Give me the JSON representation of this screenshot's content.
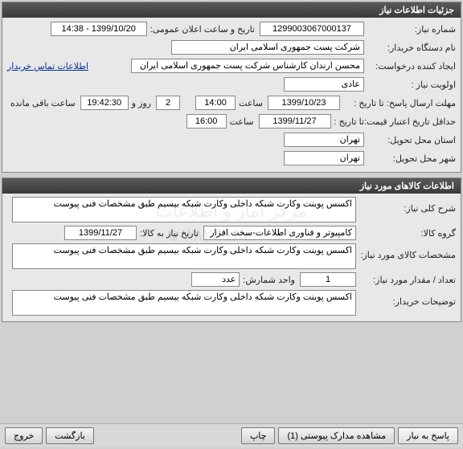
{
  "panel1": {
    "title": "جزئیات اطلاعات نیاز",
    "need_no_lbl": "شماره نیاز:",
    "need_no": "1299003067000137",
    "announce_lbl": "تاریخ و ساعت اعلان عمومی:",
    "announce_val": "1399/10/20 - 14:38",
    "org_lbl": "نام دستگاه خریدار:",
    "org_val": "شرکت پست جمهوری اسلامی ایران",
    "creator_lbl": "ایجاد کننده درخواست:",
    "creator_val": "محسن ارندان کارشناس شرکت پست جمهوری اسلامی ایران",
    "contact_link": "اطلاعات تماس خریدار",
    "priority_lbl": "اولویت نیاز :",
    "priority_val": "عادی",
    "deadline_lbl": "مهلت ارسال پاسخ:  تا تاریخ :",
    "deadline_date": "1399/10/23",
    "time_lbl": "ساعت",
    "deadline_time": "14:00",
    "days_val": "2",
    "days_lbl": "روز و",
    "remain_time": "19:42:30",
    "remain_lbl": "ساعت باقی مانده",
    "valid_lbl": "حداقل تاریخ اعتبار قیمت:",
    "valid_until_lbl": "تا تاریخ :",
    "valid_date": "1399/11/27",
    "valid_time": "16:00",
    "province_lbl": "استان محل تحویل:",
    "province_val": "تهران",
    "city_lbl": "شهر محل تحویل:",
    "city_val": "تهران"
  },
  "panel2": {
    "title": "اطلاعات کالاهای مورد نیاز",
    "desc_lbl": "شرح کلی نیاز:",
    "desc_val": "اکسس پوینت وکارت شبکه داخلی وکارت شبکه بیسیم طبق مشخصات فنی پیوست",
    "group_lbl": "گروه کالا:",
    "group_val": "کامپیوتر و فناوری اطلاعات-سخت افزار",
    "need_date_lbl": "تاریخ نیاز به کالا:",
    "need_date_val": "1399/11/27",
    "spec_lbl": "مشخصات کالای مورد نیاز:",
    "spec_val": "اکسس پوینت وکارت شبکه داخلی وکارت شبکه بیسیم طبق مشخصات فنی پیوست",
    "qty_lbl": "تعداد / مقدار مورد نیاز:",
    "qty_val": "1",
    "unit_lbl": "واحد شمارش:",
    "unit_val": "عدد",
    "buyer_notes_lbl": "توضیحات خریدار:",
    "buyer_notes_val": "اکسس پوینت وکارت شبکه داخلی وکارت شبکه بیسیم طبق مشخصات فنی پیوست"
  },
  "buttons": {
    "respond": "پاسخ به نیاز",
    "attachments": "مشاهده مدارک پیوستی  (1)",
    "print": "چاپ",
    "back": "بازگشت",
    "exit": "خروج"
  },
  "watermark": "مرکز آمار و اطلاعات\n۰۲۱-۸۸۲۴۹۶۷۰-۵"
}
